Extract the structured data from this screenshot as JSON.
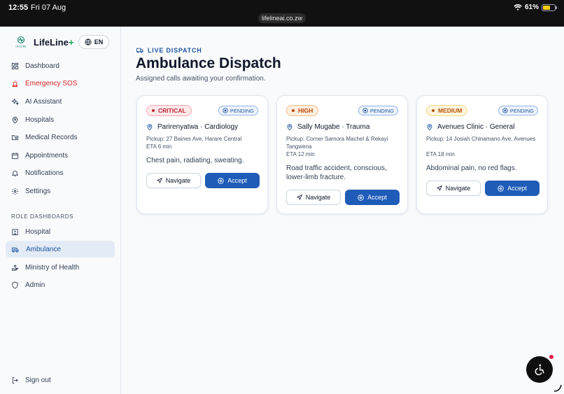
{
  "status_bar": {
    "time": "12:55",
    "date": "Fri 07 Aug",
    "url": "lifelineai.co.zw",
    "battery": "61%",
    "battery_level": 0.61
  },
  "sidebar": {
    "brand_name": "LifeLine",
    "brand_suffix": "+",
    "logo_text": "LIFELINE",
    "language": "EN",
    "nav": [
      {
        "label": "Dashboard",
        "icon": "dashboard-icon"
      },
      {
        "label": "Emergency SOS",
        "icon": "siren-icon"
      },
      {
        "label": "AI Assistant",
        "icon": "sparkles-icon"
      },
      {
        "label": "Hospitals",
        "icon": "map-pin-icon"
      },
      {
        "label": "Medical Records",
        "icon": "folder-heart-icon"
      },
      {
        "label": "Appointments",
        "icon": "calendar-icon"
      },
      {
        "label": "Notifications",
        "icon": "bell-icon"
      },
      {
        "label": "Settings",
        "icon": "gear-icon"
      }
    ],
    "role_section_label": "ROLE DASHBOARDS",
    "role_nav": [
      {
        "label": "Hospital",
        "icon": "hospital-icon"
      },
      {
        "label": "Ambulance",
        "icon": "ambulance-icon",
        "active": true
      },
      {
        "label": "Ministry of Health",
        "icon": "hand-heart-icon"
      },
      {
        "label": "Admin",
        "icon": "shield-icon"
      }
    ],
    "sign_out": "Sign out"
  },
  "main": {
    "kicker": "LIVE DISPATCH",
    "title": "Ambulance Dispatch",
    "subtitle": "Assigned calls awaiting your confirmation.",
    "cards": [
      {
        "severity": "CRITICAL",
        "status": "PENDING",
        "facility": "Parirenyatwa · Cardiology",
        "pickup": "Pickup: 27 Baines Ave, Harare Central",
        "eta": "ETA 6 min",
        "description": "Chest pain, radiating, sweating.",
        "navigate_label": "Navigate",
        "accept_label": "Accept"
      },
      {
        "severity": "HIGH",
        "status": "PENDING",
        "facility": "Sally Mugabe · Trauma",
        "pickup": "Pickup: Corner Samora Machel & Rekayi Tangwena",
        "eta": "ETA 12 min",
        "description": "Road traffic accident, conscious, lower-limb fracture.",
        "navigate_label": "Navigate",
        "accept_label": "Accept"
      },
      {
        "severity": "MEDIUM",
        "status": "PENDING",
        "facility": "Avenues Clinic · General",
        "pickup": "Pickup: 14 Josiah Chinamano Ave, Avenues",
        "eta": "ETA 18 min",
        "description": "Abdominal pain, no red flags.",
        "navigate_label": "Navigate",
        "accept_label": "Accept"
      }
    ]
  },
  "colors": {
    "primary": "#1f5cb8",
    "critical": "#c02636",
    "high": "#c2410c",
    "medium": "#b45309",
    "sos": "#dc2626",
    "brand_plus": "#16a34a"
  },
  "floating": {
    "icon": "accessibility-icon"
  }
}
